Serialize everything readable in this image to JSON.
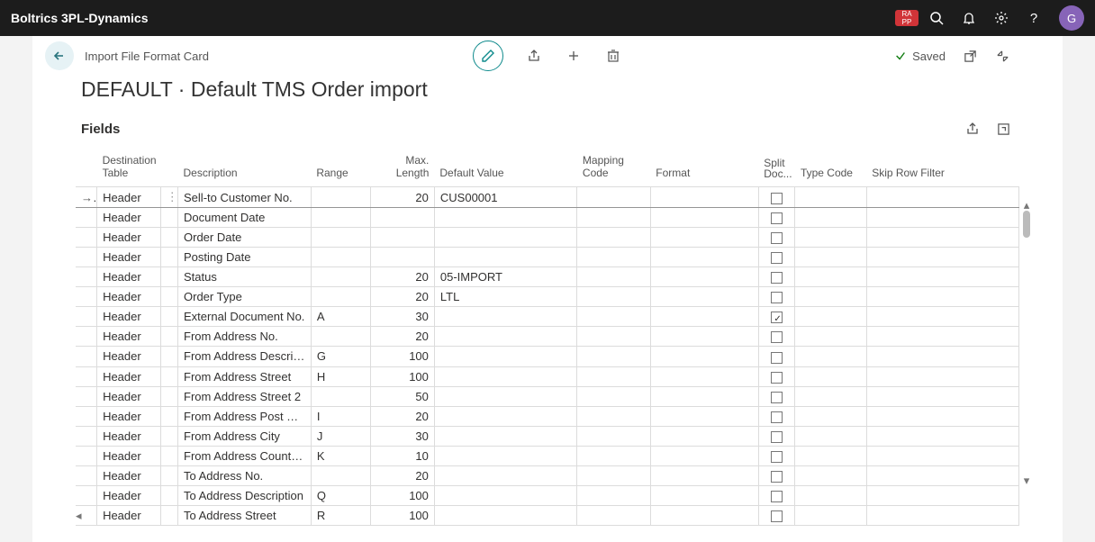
{
  "topbar": {
    "brand": "Boltrics 3PL-Dynamics",
    "badge_line1": "RA",
    "badge_line2": "PP",
    "avatar": "G"
  },
  "header": {
    "breadcrumb": "Import File Format Card",
    "saved_label": "Saved"
  },
  "page_title": "DEFAULT · Default TMS Order import",
  "section_title": "Fields",
  "columns": {
    "dest": "Destination Table",
    "desc": "Description",
    "range": "Range",
    "max": "Max. Length",
    "default": "Default Value",
    "map": "Mapping Code",
    "format": "Format",
    "split": "Split Doc...",
    "type": "Type Code",
    "skip": "Skip Row Filter"
  },
  "rows": [
    {
      "sel": true,
      "dest": "Header",
      "desc": "Sell-to Customer No.",
      "range": "",
      "max": "20",
      "default": "CUS00001",
      "split": false
    },
    {
      "sel": false,
      "dest": "Header",
      "desc": "Document Date",
      "range": "",
      "max": "",
      "default": "",
      "split": false
    },
    {
      "sel": false,
      "dest": "Header",
      "desc": "Order Date",
      "range": "",
      "max": "",
      "default": "",
      "split": false
    },
    {
      "sel": false,
      "dest": "Header",
      "desc": "Posting Date",
      "range": "",
      "max": "",
      "default": "",
      "split": false
    },
    {
      "sel": false,
      "dest": "Header",
      "desc": "Status",
      "range": "",
      "max": "20",
      "default": "05-IMPORT",
      "split": false
    },
    {
      "sel": false,
      "dest": "Header",
      "desc": "Order Type",
      "range": "",
      "max": "20",
      "default": "LTL",
      "split": false
    },
    {
      "sel": false,
      "dest": "Header",
      "desc": "External Document No.",
      "range": "A",
      "max": "30",
      "default": "",
      "split": true
    },
    {
      "sel": false,
      "dest": "Header",
      "desc": "From Address No.",
      "range": "",
      "max": "20",
      "default": "",
      "split": false
    },
    {
      "sel": false,
      "dest": "Header",
      "desc": "From Address Description",
      "range": "G",
      "max": "100",
      "default": "",
      "split": false
    },
    {
      "sel": false,
      "dest": "Header",
      "desc": "From Address Street",
      "range": "H",
      "max": "100",
      "default": "",
      "split": false
    },
    {
      "sel": false,
      "dest": "Header",
      "desc": "From Address Street 2",
      "range": "",
      "max": "50",
      "default": "",
      "split": false
    },
    {
      "sel": false,
      "dest": "Header",
      "desc": "From Address Post Code",
      "range": "I",
      "max": "20",
      "default": "",
      "split": false
    },
    {
      "sel": false,
      "dest": "Header",
      "desc": "From Address City",
      "range": "J",
      "max": "30",
      "default": "",
      "split": false
    },
    {
      "sel": false,
      "dest": "Header",
      "desc": "From Address Country Co...",
      "range": "K",
      "max": "10",
      "default": "",
      "split": false
    },
    {
      "sel": false,
      "dest": "Header",
      "desc": "To Address No.",
      "range": "",
      "max": "20",
      "default": "",
      "split": false
    },
    {
      "sel": false,
      "dest": "Header",
      "desc": "To Address Description",
      "range": "Q",
      "max": "100",
      "default": "",
      "split": false
    },
    {
      "sel": false,
      "dest": "Header",
      "desc": "To Address Street",
      "range": "R",
      "max": "100",
      "default": "",
      "split": false
    }
  ]
}
